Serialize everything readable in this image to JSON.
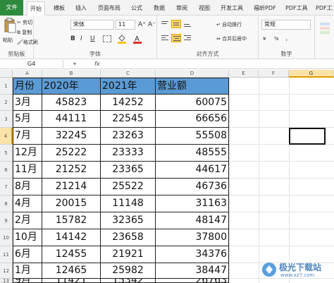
{
  "menu": {
    "file": "文件",
    "tabs": [
      "开始",
      "插入",
      "页面布局",
      "公式",
      "数据",
      "审阅",
      "视图",
      "开发工具",
      "福昕PDF",
      "PDF工具",
      "PDF工"
    ],
    "active_tab": "开始",
    "active_icon_label": "横板"
  },
  "ribbon": {
    "clipboard": {
      "paste": "粘贴",
      "cut": "剪切",
      "copy": "复制",
      "format_painter": "格式刷",
      "label": "剪贴板"
    },
    "font": {
      "name": "宋体",
      "size": "11",
      "bold": "B",
      "italic": "I",
      "underline": "U",
      "label": "字体",
      "grow": "A⁺",
      "shrink": "A⁻"
    },
    "alignment": {
      "wrap": "自动换行",
      "merge": "合并后居中",
      "label": "对齐方式"
    },
    "number": {
      "format": "常规",
      "label": "数字",
      "percent": "%",
      "comma": "，"
    },
    "colors": {
      "fill": "#f6c21b",
      "font": "#e0302a",
      "green": "#2e8b3e"
    }
  },
  "formula_bar": {
    "name_box": "G4",
    "fx": "fx",
    "value": ""
  },
  "sheet": {
    "columns": [
      "A",
      "B",
      "C",
      "D",
      "E",
      "F",
      "G"
    ],
    "selected_column": "G",
    "rows": [
      "1",
      "2",
      "3",
      "4",
      "5",
      "6",
      "7",
      "8",
      "9",
      "10",
      "11",
      "12",
      "13"
    ],
    "selected_row": "4",
    "header": [
      "月份",
      "2020年",
      "2021年",
      "营业额"
    ],
    "data": [
      [
        "3月",
        "45823",
        "14252",
        "60075"
      ],
      [
        "5月",
        "44111",
        "22545",
        "66656"
      ],
      [
        "7月",
        "32245",
        "23263",
        "55508"
      ],
      [
        "12月",
        "25222",
        "23333",
        "48555"
      ],
      [
        "11月",
        "21252",
        "23365",
        "44617"
      ],
      [
        "8月",
        "21214",
        "25522",
        "46736"
      ],
      [
        "4月",
        "20015",
        "11148",
        "31163"
      ],
      [
        "2月",
        "15782",
        "32365",
        "48147"
      ],
      [
        "10月",
        "14142",
        "23658",
        "37800"
      ],
      [
        "6月",
        "12455",
        "21921",
        "34376"
      ],
      [
        "1月",
        "12465",
        "25982",
        "38447"
      ],
      [
        "9月",
        "11421",
        "15342",
        "26763"
      ]
    ],
    "header_color": "#5b9bd5",
    "selected_cell": "G4"
  },
  "watermark": {
    "text": "极光下载站",
    "url": "www.xz7.com"
  }
}
